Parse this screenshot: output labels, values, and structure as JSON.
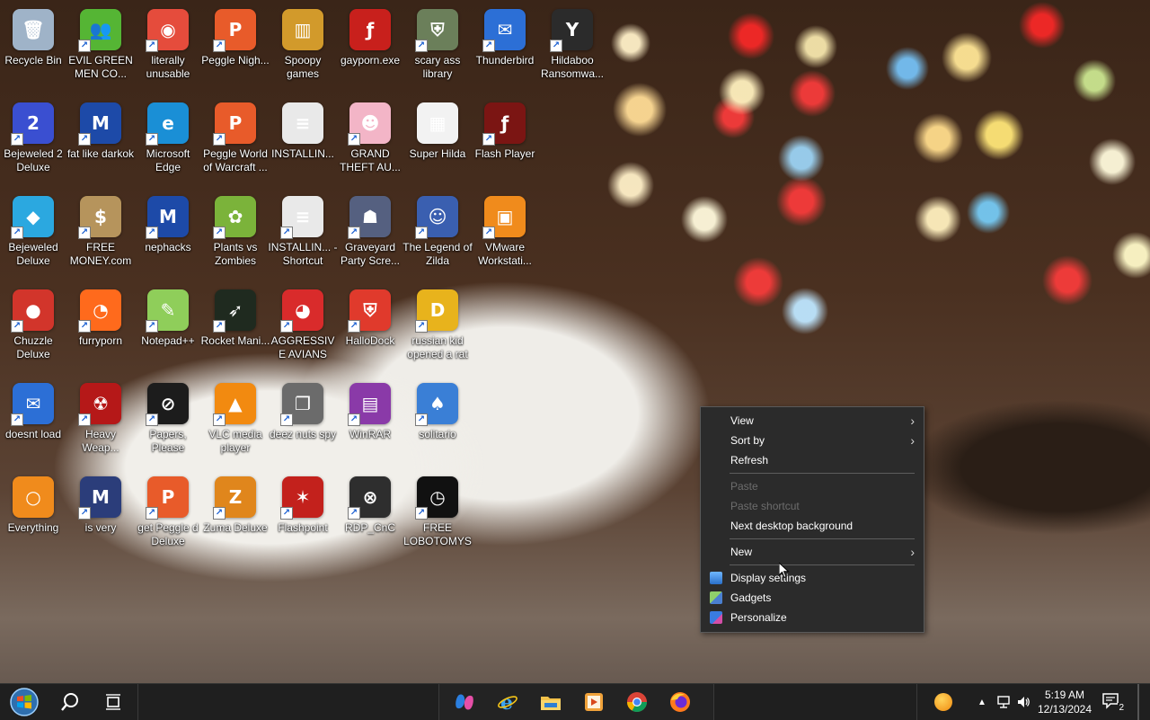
{
  "desktop": {
    "icons": [
      {
        "label": "Recycle Bin",
        "shortcut": false,
        "color": "#9fb3c8",
        "glyph": "🗑"
      },
      {
        "label": "EVIL GREEN MEN CO...",
        "shortcut": true,
        "color": "#55b534",
        "glyph": "👥"
      },
      {
        "label": "literally unusable",
        "shortcut": true,
        "color": "#e54c3c",
        "glyph": "◉"
      },
      {
        "label": "Peggle Nigh...",
        "shortcut": true,
        "color": "#e85b2a",
        "glyph": "P"
      },
      {
        "label": "Spoopy games",
        "shortcut": false,
        "color": "#d29a2b",
        "glyph": "▥"
      },
      {
        "label": "gayporn.exe",
        "shortcut": false,
        "color": "#c8201c",
        "glyph": "ƒ"
      },
      {
        "label": "scary ass library",
        "shortcut": true,
        "color": "#6b7f5a",
        "glyph": "⛨"
      },
      {
        "label": "Thunderbird",
        "shortcut": true,
        "color": "#2c6fd6",
        "glyph": "✉"
      },
      {
        "label": "Hildaboo Ransomwa...",
        "shortcut": true,
        "color": "#2b2b2b",
        "glyph": "Y"
      },
      {
        "label": "Bejeweled 2 Deluxe",
        "shortcut": true,
        "color": "#3a4fd1",
        "glyph": "2"
      },
      {
        "label": "fat like darkok",
        "shortcut": true,
        "color": "#1d4aa8",
        "glyph": "M"
      },
      {
        "label": "Microsoft Edge",
        "shortcut": true,
        "color": "#1a8fd6",
        "glyph": "e"
      },
      {
        "label": "Peggle World of Warcraft ...",
        "shortcut": true,
        "color": "#e85b2a",
        "glyph": "P"
      },
      {
        "label": "INSTALLIN...",
        "shortcut": false,
        "color": "#e9e9e9",
        "glyph": "≡"
      },
      {
        "label": "GRAND THEFT AU...",
        "shortcut": true,
        "color": "#f3b5c7",
        "glyph": "☻"
      },
      {
        "label": "Super Hilda",
        "shortcut": false,
        "color": "#f2f2f2",
        "glyph": "▦"
      },
      {
        "label": "Flash Player",
        "shortcut": true,
        "color": "#7b1513",
        "glyph": "ƒ"
      },
      {
        "label": "Bejeweled Deluxe",
        "shortcut": true,
        "color": "#2ba8e0",
        "glyph": "◆"
      },
      {
        "label": "FREE MONEY.com",
        "shortcut": true,
        "color": "#b6945c",
        "glyph": "$"
      },
      {
        "label": "nephacks",
        "shortcut": true,
        "color": "#1d4aa8",
        "glyph": "M"
      },
      {
        "label": "Plants vs Zombies",
        "shortcut": true,
        "color": "#7bb33a",
        "glyph": "✿"
      },
      {
        "label": "INSTALLIN... - Shortcut",
        "shortcut": true,
        "color": "#e9e9e9",
        "glyph": "≡"
      },
      {
        "label": "Graveyard Party Scre...",
        "shortcut": true,
        "color": "#556080",
        "glyph": "☗"
      },
      {
        "label": "The Legend of Zilda",
        "shortcut": true,
        "color": "#3a5fb0",
        "glyph": "☺"
      },
      {
        "label": "VMware Workstati...",
        "shortcut": true,
        "color": "#f08b1c",
        "glyph": "▣"
      },
      {
        "label": "Chuzzle Deluxe",
        "shortcut": true,
        "color": "#d2352b",
        "glyph": "●"
      },
      {
        "label": "furryporn",
        "shortcut": true,
        "color": "#ff6a1c",
        "glyph": "◔"
      },
      {
        "label": "Notepad++",
        "shortcut": true,
        "color": "#8fce5a",
        "glyph": "✎"
      },
      {
        "label": "Rocket Mani...",
        "shortcut": true,
        "color": "#1f2a1f",
        "glyph": "➶"
      },
      {
        "label": "AGGRESSIVE AVIANS",
        "shortcut": true,
        "color": "#d92b2b",
        "glyph": "◕"
      },
      {
        "label": "HalloDock",
        "shortcut": true,
        "color": "#e03a2c",
        "glyph": "⛨"
      },
      {
        "label": "russian kid opened a rat",
        "shortcut": true,
        "color": "#e8b31c",
        "glyph": "D"
      },
      {
        "label": "doesnt load",
        "shortcut": true,
        "color": "#2c6fd6",
        "glyph": "✉"
      },
      {
        "label": "Heavy Weap...",
        "shortcut": true,
        "color": "#b51818",
        "glyph": "☢"
      },
      {
        "label": "Papers, Please",
        "shortcut": true,
        "color": "#1c1c1c",
        "glyph": "⊘"
      },
      {
        "label": "VLC media player",
        "shortcut": true,
        "color": "#f28a10",
        "glyph": "▲"
      },
      {
        "label": "deez nuts spy",
        "shortcut": true,
        "color": "#6b6b6b",
        "glyph": "❐"
      },
      {
        "label": "WinRAR",
        "shortcut": true,
        "color": "#8a3aa8",
        "glyph": "▤"
      },
      {
        "label": "solitario",
        "shortcut": true,
        "color": "#3a7fd6",
        "glyph": "♠"
      },
      {
        "label": "Everything",
        "shortcut": false,
        "color": "#f08b1c",
        "glyph": "○"
      },
      {
        "label": "is very",
        "shortcut": true,
        "color": "#2b3d7a",
        "glyph": "M"
      },
      {
        "label": "get Peggle d Deluxe",
        "shortcut": true,
        "color": "#e85b2a",
        "glyph": "P"
      },
      {
        "label": "Zuma Deluxe",
        "shortcut": true,
        "color": "#e0861c",
        "glyph": "Z"
      },
      {
        "label": "Flashpoint",
        "shortcut": true,
        "color": "#c3211c",
        "glyph": "✶"
      },
      {
        "label": "RDP_CnC",
        "shortcut": true,
        "color": "#2e2e2e",
        "glyph": "⊗"
      },
      {
        "label": "FREE LOBOTOMYS",
        "shortcut": true,
        "color": "#111111",
        "glyph": "◷"
      }
    ]
  },
  "context_menu": {
    "items": [
      {
        "label": "View",
        "submenu": true,
        "disabled": false
      },
      {
        "label": "Sort by",
        "submenu": true,
        "disabled": false
      },
      {
        "label": "Refresh",
        "submenu": false,
        "disabled": false
      },
      {
        "label": "Paste",
        "submenu": false,
        "disabled": true
      },
      {
        "label": "Paste shortcut",
        "submenu": false,
        "disabled": true
      },
      {
        "label": "Next desktop background",
        "submenu": false,
        "disabled": false
      },
      {
        "label": "New",
        "submenu": true,
        "disabled": false
      },
      {
        "label": "Display settings",
        "submenu": false,
        "disabled": false,
        "icon": "display-icon"
      },
      {
        "label": "Gadgets",
        "submenu": false,
        "disabled": false,
        "icon": "gadgets-icon"
      },
      {
        "label": "Personalize",
        "submenu": false,
        "disabled": false,
        "icon": "personalize-icon"
      }
    ]
  },
  "taskbar": {
    "clock_time": "5:19 AM",
    "clock_date": "12/13/2024",
    "notification_count": "2"
  },
  "colors": {
    "menu_bg": "#2b2b2b",
    "taskbar_bg": "#1f1f1f",
    "start_orb": "#3aa0e0"
  }
}
